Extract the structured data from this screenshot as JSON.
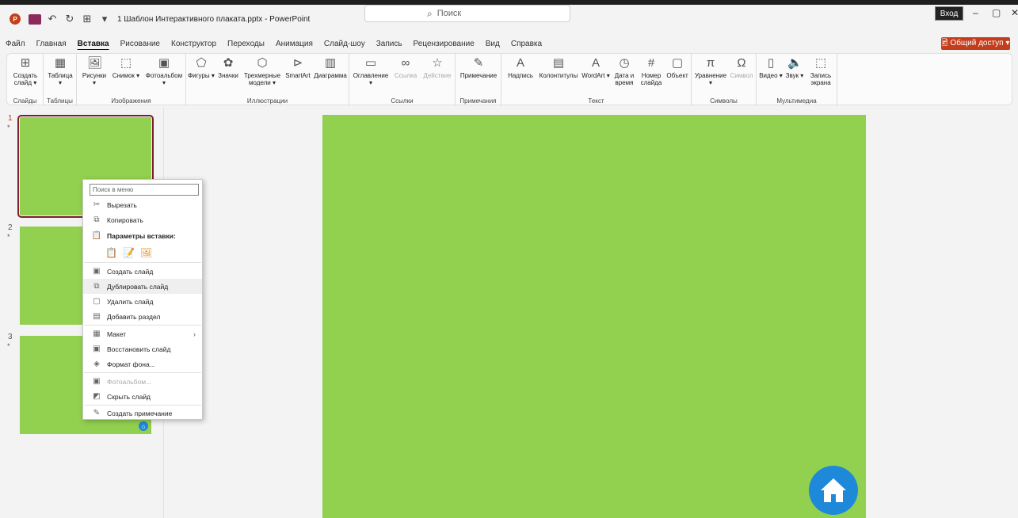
{
  "titlebar": {
    "app_badge": "P",
    "doc_title": "1 Шаблон Интерактивного плаката.pptx  -  PowerPoint",
    "search_placeholder": "Поиск",
    "login": "Вход",
    "minimize": "–",
    "maximize": "▢",
    "close": "✕"
  },
  "menu": {
    "tabs": [
      "Файл",
      "Главная",
      "Вставка",
      "Рисование",
      "Конструктор",
      "Переходы",
      "Анимация",
      "Слайд-шоу",
      "Запись",
      "Рецензирование",
      "Вид",
      "Справка"
    ],
    "active_tab": "Вставка",
    "share": "🖻 Общий доступ ▾"
  },
  "ribbon": {
    "groups": {
      "slides": "Слайды",
      "tables": "Таблицы",
      "images": "Изображения",
      "illustrations": "Иллюстрации",
      "links": "Ссылки",
      "comments": "Примечания",
      "text": "Текст",
      "symbols": "Символы",
      "media": "Мультимедиа"
    },
    "buttons": {
      "new_slide": "Создать слайд ▾",
      "table": "Таблица ▾",
      "pictures": "Рисунки ▾",
      "screenshot": "Снимок ▾",
      "photo_album": "Фотоальбом ▾",
      "shapes": "Фигуры ▾",
      "icons": "Значки",
      "3d_models": "Трехмерные модели ▾",
      "smartart": "SmartArt",
      "chart": "Диаграмма",
      "zoom": "Оглавление ▾",
      "link": "Ссылка",
      "action": "Действие",
      "comment": "Примечание",
      "textbox": "Надпись",
      "header_footer": "Колонтитулы",
      "wordart": "WordArt ▾",
      "date_time": "Дата и время",
      "slide_number": "Номер слайда",
      "object": "Объект",
      "equation": "Уравнение ▾",
      "symbol": "Символ",
      "video": "Видео ▾",
      "audio": "Звук ▾",
      "screen_recording": "Запись экрана"
    }
  },
  "slides": [
    {
      "num": "1",
      "star": "*"
    },
    {
      "num": "2",
      "star": "*"
    },
    {
      "num": "3",
      "star": "*"
    }
  ],
  "context_menu": {
    "search_placeholder": "Поиск в меню",
    "items": {
      "cut": "Вырезать",
      "copy": "Копировать",
      "paste_options": "Параметры вставки:",
      "new_slide": "Создать слайд",
      "duplicate": "Дублировать слайд",
      "delete": "Удалить слайд",
      "add_section": "Добавить раздел",
      "layout": "Макет",
      "reset": "Восстановить слайд",
      "format_bg": "Формат фона...",
      "photo_album": "Фотоальбом...",
      "hide": "Скрыть слайд",
      "new_comment": "Создать примечание"
    }
  },
  "colors": {
    "slide_bg": "#92d050",
    "home_button": "#1e88d9",
    "accent": "#c43e1c"
  }
}
